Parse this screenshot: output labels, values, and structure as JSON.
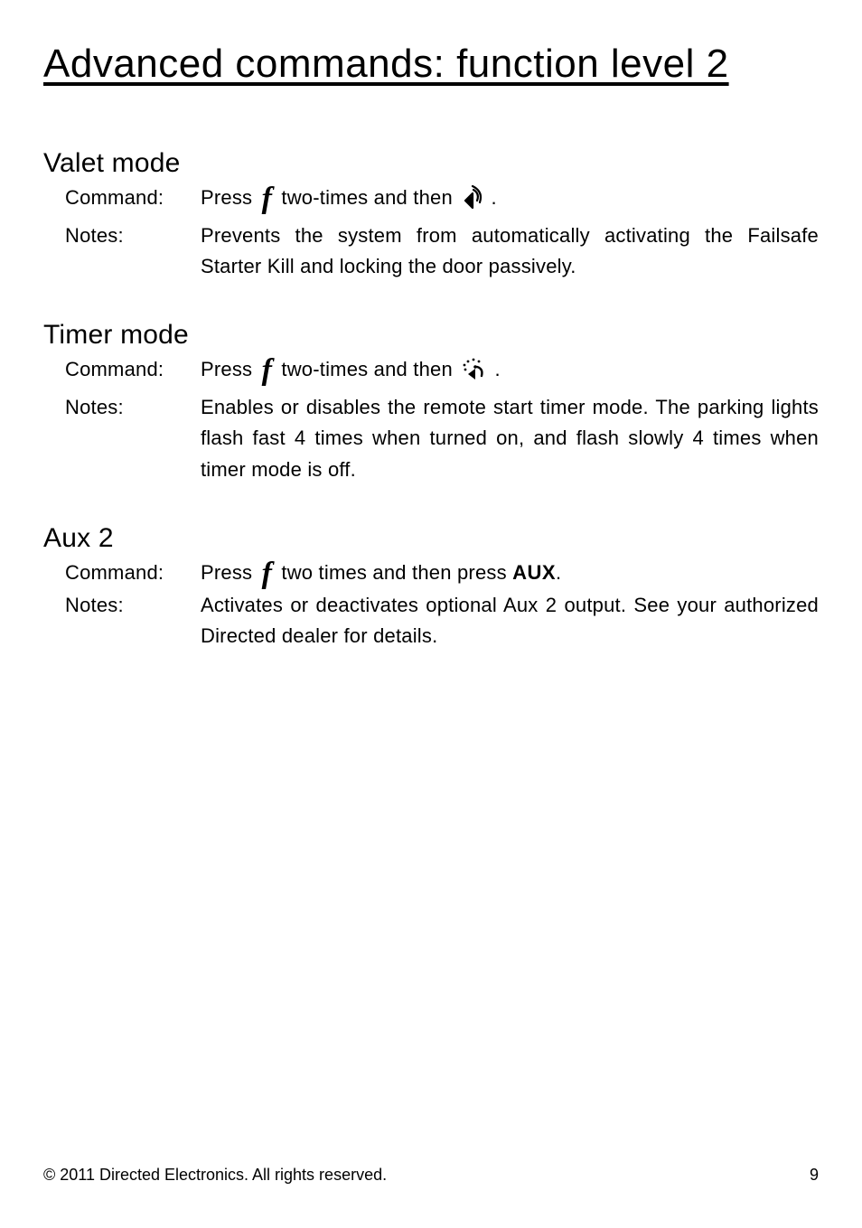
{
  "title": "Advanced commands: function level 2",
  "sections": [
    {
      "heading": "Valet mode",
      "commandLabel": "Command",
      "commandPre": "Press ",
      "commandMid": " two-times and then ",
      "commandPost": " .",
      "icon2": "speaker",
      "notesLabel": "Notes:",
      "notes": "Prevents the system from automatically activating the Failsafe Starter Kill and locking the door passively."
    },
    {
      "heading": "Timer mode",
      "commandLabel": "Command",
      "commandPre": "Press ",
      "commandMid": " two-times and then ",
      "commandPost": ".",
      "icon2": "remote",
      "notesLabel": "Notes",
      "notes": "Enables or disables the remote start timer mode. The parking lights flash fast 4 times when turned on, and flash slowly 4 times when timer mode is off."
    },
    {
      "heading": "Aux 2",
      "commandLabel": "Command",
      "commandPre": "Press ",
      "commandMid": " two times and then press ",
      "commandAux": "AUX",
      "commandPost": ".",
      "icon2": "aux",
      "notesLabel": "Notes",
      "notes": "Activates or deactivates optional Aux 2 output. See your authorized Directed dealer for details."
    }
  ],
  "footer": {
    "copyright": "© 2011 Directed Electronics. All rights reserved.",
    "page": "9"
  }
}
